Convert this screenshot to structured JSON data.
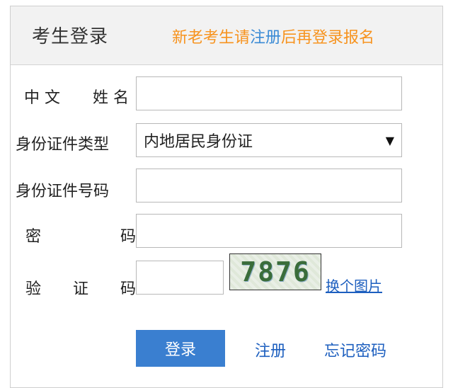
{
  "header": {
    "title": "考生登录",
    "notice_pre": "新老考生请",
    "notice_link": "注册",
    "notice_post": "后再登录报名"
  },
  "form": {
    "name_label_a": "中 文",
    "name_label_b": "姓 名",
    "id_type_label": "身份证件类型",
    "id_type_value": "内地居民身份证",
    "id_number_label": "身份证件号码",
    "password_label_a": "密",
    "password_label_b": "码",
    "captcha_label_a": "验",
    "captcha_label_b": "证",
    "captcha_label_c": "码",
    "captcha_code": "7876",
    "captcha_swap": "换个图片"
  },
  "actions": {
    "login": "登录",
    "register": "注册",
    "forgot": "忘记密码"
  },
  "colors": {
    "notice": "#f7931e",
    "link": "#1d5fbf",
    "button": "#3a7fd0"
  }
}
